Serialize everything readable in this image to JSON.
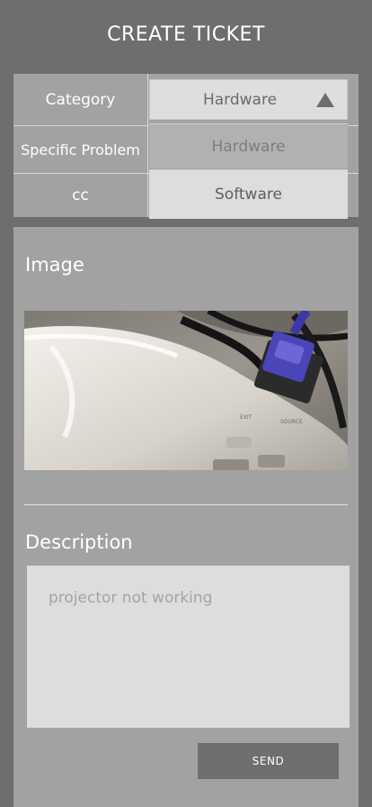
{
  "header": {
    "title": "CREATE TICKET"
  },
  "form": {
    "category_label": "Category",
    "specific_problem_label": "Specific Problem",
    "cc_label": "cc",
    "category_select": {
      "value": "Hardware",
      "options": [
        "Hardware",
        "Software"
      ]
    }
  },
  "image_section": {
    "title": "Image",
    "photo_icon": "projector-photo"
  },
  "description_section": {
    "title": "Description",
    "placeholder": "projector not working"
  },
  "actions": {
    "send_label": "SEND"
  },
  "colors": {
    "background": "#6e6e6e",
    "card": "#a2a2a2",
    "input": "#dddddd",
    "button": "#6f6f6f"
  }
}
